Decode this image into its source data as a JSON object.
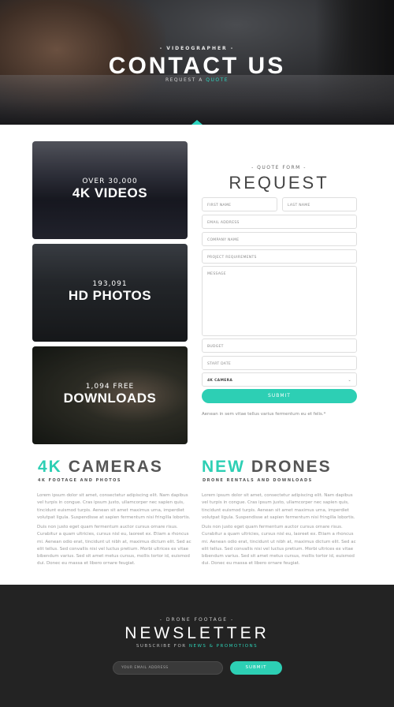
{
  "hero": {
    "pre_title": "- VIDEOGRAPHER -",
    "title": "CONTACT US",
    "sub_prefix": "REQUEST A",
    "sub_accent": "QUOTE"
  },
  "cards": [
    {
      "small": "OVER 30,000",
      "big": "4K VIDEOS"
    },
    {
      "small": "193,091",
      "big": "HD PHOTOS"
    },
    {
      "small": "1,094 FREE",
      "big": "DOWNLOADS"
    }
  ],
  "form": {
    "pre_title": "- QUOTE FORM -",
    "title": "REQUEST",
    "first_name": "FIRST NAME",
    "last_name": "LAST NAME",
    "email": "EMAIL ADDRESS",
    "company": "COMPANY NAME",
    "requirements": "PROJECT REQUIREMENTS",
    "message": "MESSAGE",
    "budget": "BUDGET",
    "start_date": "START DATE",
    "camera_selected": "4K CAMERA",
    "submit": "SUBMIT",
    "note": "Aenean in sem vitae tellus varius fermentum eu et felis.*"
  },
  "columns": [
    {
      "accent": "4K",
      "heading": "CAMERAS",
      "sub": "4K FOOTAGE AND PHOTOS",
      "p1": "Lorem ipsum dolor sit amet, consectetur adipiscing elit. Nam dapibus vel turpis in congue. Cras ipsum justo, ullamcorper nec sapien quis, tincidunt euismod turpis. Aenean sit amet maximus urna, imperdiet volutpat ligula. Suspendisse at sapien fermentum nisi fringilla lobortis.",
      "p2": "Duis non justo eget quam fermentum auctor cursus ornare risus. Curabitur a quam ultricies, cursus nisl eu, laoreet ex. Etiam a rhoncus mi. Aenean odio erat, tincidunt ut nibh at, maximus dictum elit. Sed ac elit tellus. Sed convallis nisi vel luctus pretium. Morbi ultrices ex vitae bibendum varius. Sed sit amet metus cursus, mollis tortor id, euismod dui. Donec eu massa et libero ornare feugiat."
    },
    {
      "accent": "NEW",
      "heading": "DRONES",
      "sub": "DRONE RENTALS AND DOWNLOADS",
      "p1": "Lorem ipsum dolor sit amet, consectetur adipiscing elit. Nam dapibus vel turpis in congue. Cras ipsum justo, ullamcorper nec sapien quis, tincidunt euismod turpis. Aenean sit amet maximus urna, imperdiet volutpat ligula. Suspendisse at sapien fermentum nisi fringilla lobortis.",
      "p2": "Duis non justo eget quam fermentum auctor cursus ornare risus. Curabitur a quam ultricies, cursus nisl eu, laoreet ex. Etiam a rhoncus mi. Aenean odio erat, tincidunt ut nibh at, maximus dictum elit. Sed ac elit tellus. Sed convallis nisi vel luctus pretium. Morbi ultrices ex vitae bibendum varius. Sed sit amet metus cursus, mollis tortor id, euismod dui. Donec eu massa et libero ornare feugiat."
    }
  ],
  "newsletter": {
    "pre_title": "- DRONE FOOTAGE -",
    "title": "NEWSLETTER",
    "sub_prefix": "SUBSCRIBE FOR",
    "sub_accent": "NEWS & PROMOTIONS",
    "email_placeholder": "YOUR EMAIL ADDRESS",
    "submit": "SUBMIT"
  },
  "colors": {
    "accent": "#2dcfb4",
    "footer_bg": "#232323"
  }
}
